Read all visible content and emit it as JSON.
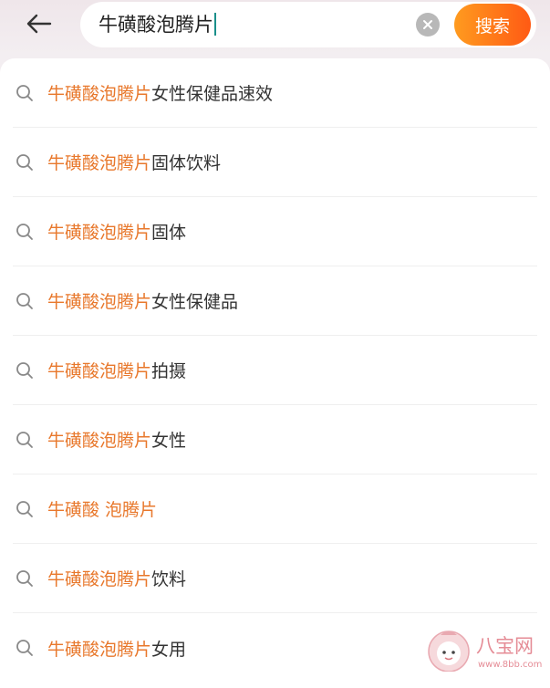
{
  "search": {
    "query": "牛磺酸泡腾片",
    "submit_label": "搜索"
  },
  "suggestions": [
    {
      "highlight": "牛磺酸泡腾片",
      "rest": "女性保健品速效"
    },
    {
      "highlight": "牛磺酸泡腾片",
      "rest": "固体饮料"
    },
    {
      "highlight": "牛磺酸泡腾片",
      "rest": "固体"
    },
    {
      "highlight": "牛磺酸泡腾片",
      "rest": "女性保健品"
    },
    {
      "highlight": "牛磺酸泡腾片",
      "rest": "拍摄"
    },
    {
      "highlight": "牛磺酸泡腾片",
      "rest": "女性"
    },
    {
      "highlight": "牛磺酸 泡腾片",
      "rest": ""
    },
    {
      "highlight": "牛磺酸泡腾片",
      "rest": "饮料"
    },
    {
      "highlight": "牛磺酸泡腾片",
      "rest": "女用"
    }
  ],
  "colors": {
    "highlight": "#e8782c",
    "text": "#333333",
    "button_start": "#ff9b1f",
    "button_end": "#ff5a14",
    "caret": "#1a8f8a"
  },
  "icons": {
    "back": "arrow-left-icon",
    "clear": "clear-icon",
    "suggestion": "search-icon"
  },
  "watermark": {
    "text": "八宝网",
    "url": "www.8bb.com"
  }
}
